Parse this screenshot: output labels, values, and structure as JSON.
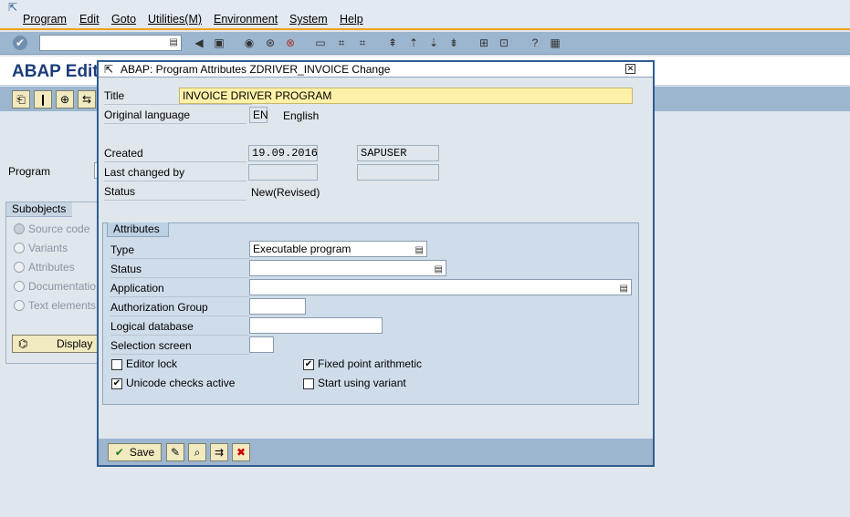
{
  "menubar": {
    "items": [
      "Program",
      "Edit",
      "Goto",
      "Utilities(M)",
      "Environment",
      "System",
      "Help"
    ]
  },
  "toolbar": {
    "command_value": "",
    "icons": [
      "enter-icon",
      "save-icon",
      "back-icon",
      "exit-icon",
      "cancel-icon",
      "print-icon",
      "find-icon",
      "find-next-icon",
      "first-page-icon",
      "prev-page-icon",
      "next-page-icon",
      "last-page-icon",
      "new-session-icon",
      "shortcut-icon",
      "help-icon",
      "layout-icon"
    ]
  },
  "app": {
    "title": "ABAP Edit",
    "program_label": "Program",
    "subobjects": {
      "header": "Subobjects",
      "items": [
        "Source code",
        "Variants",
        "Attributes",
        "Documentatio",
        "Text elements"
      ]
    },
    "display_button": "Display"
  },
  "dialog": {
    "title": "ABAP: Program Attributes ZDRIVER_INVOICE Change",
    "title_label": "Title",
    "title_value": "INVOICE DRIVER PROGRAM",
    "orig_lang_label": "Original language",
    "orig_lang_code": "EN",
    "orig_lang_name": "English",
    "created_label": "Created",
    "created_date": "19.09.2016",
    "created_user": "SAPUSER",
    "last_changed_label": "Last changed by",
    "last_changed_date": "",
    "last_changed_user": "",
    "status_label": "Status",
    "status_value": "New(Revised)",
    "attributes": {
      "header": "Attributes",
      "type_label": "Type",
      "type_value": "Executable program",
      "status_label": "Status",
      "status_value": "",
      "application_label": "Application",
      "application_value": "",
      "auth_group_label": "Authorization Group",
      "auth_group_value": "",
      "logical_db_label": "Logical database",
      "logical_db_value": "",
      "selection_screen_label": "Selection screen",
      "selection_screen_value": "",
      "editor_lock_label": "Editor lock",
      "editor_lock_checked": false,
      "unicode_label": "Unicode checks active",
      "unicode_checked": true,
      "fixed_point_label": "Fixed point arithmetic",
      "fixed_point_checked": true,
      "start_variant_label": "Start using variant",
      "start_variant_checked": false
    },
    "save_label": "Save"
  },
  "colors": {
    "accent_orange": "#f0a01e",
    "bar_blue": "#9cb6cf",
    "title_blue": "#1c3d7a",
    "input_yellow": "#fff2a8"
  }
}
